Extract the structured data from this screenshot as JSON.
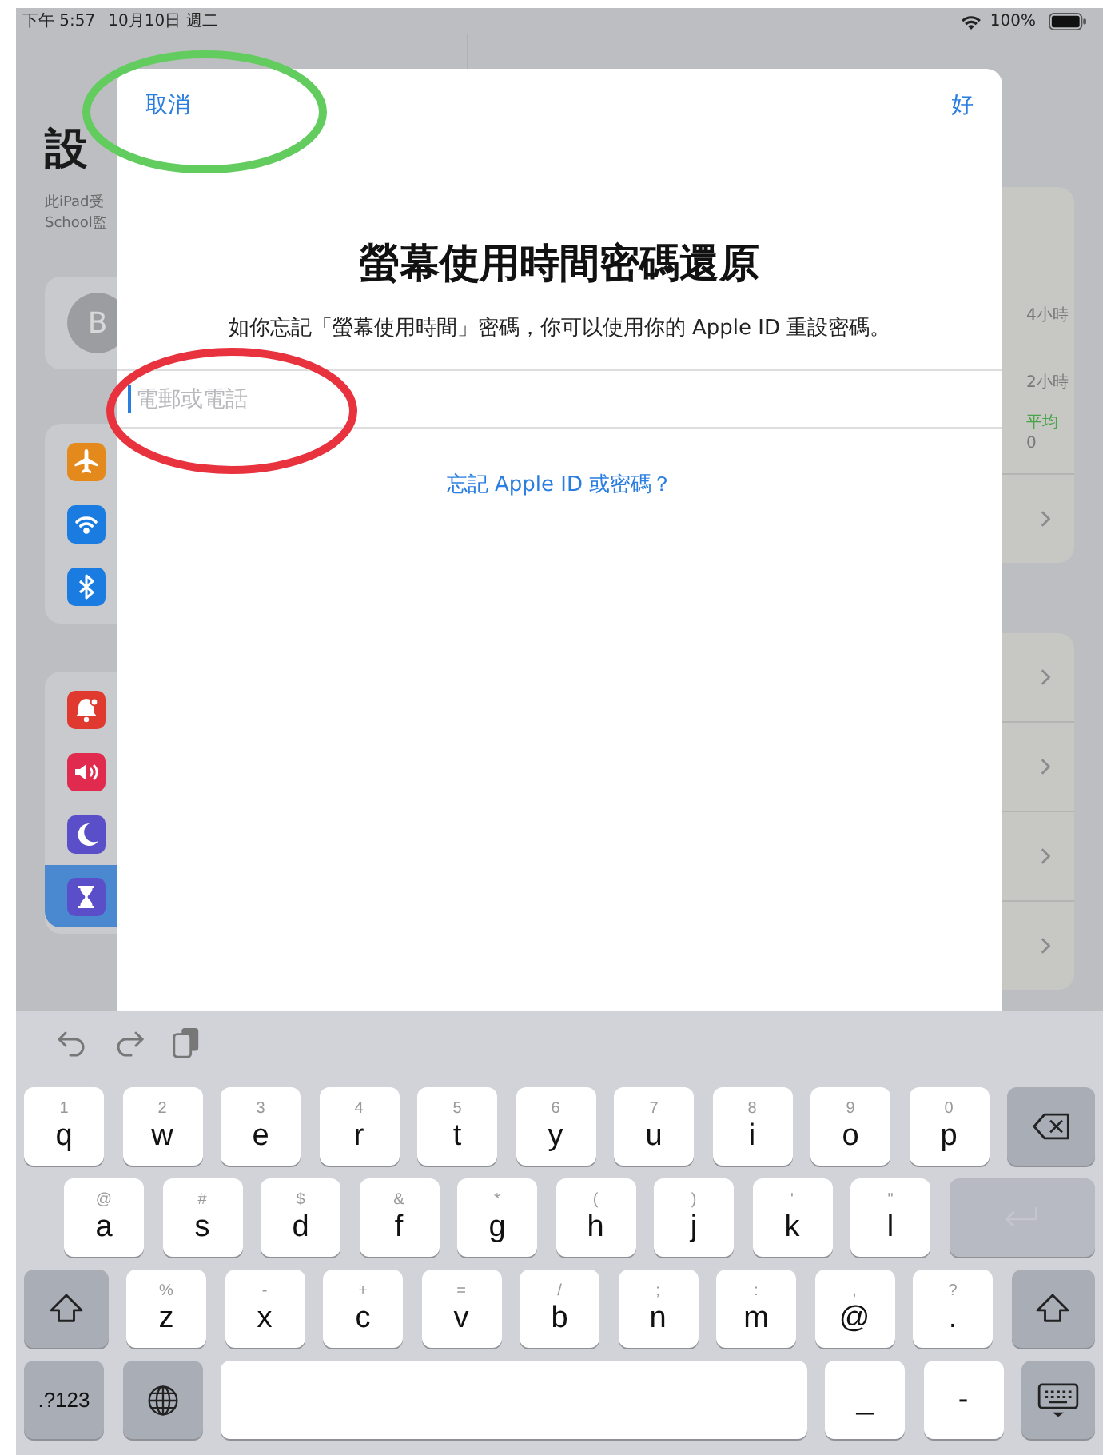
{
  "status_bar": {
    "time": "下午 5:57",
    "date": "10月10日 週二",
    "battery": "100%"
  },
  "settings": {
    "title": "設",
    "note_lines": [
      "此iPad受",
      "School監"
    ],
    "avatar": "B",
    "groups": [
      [
        {
          "kind": "airplane",
          "color": "#e48a1c",
          "selected": false
        },
        {
          "kind": "wifi",
          "color": "#1a7ce0",
          "selected": false
        },
        {
          "kind": "bluetooth",
          "color": "#1a7ce0",
          "selected": false
        }
      ],
      [
        {
          "kind": "bell",
          "color": "#e0392f",
          "selected": false
        },
        {
          "kind": "sound",
          "color": "#e02a4e",
          "selected": false
        },
        {
          "kind": "moon",
          "color": "#5a4fc8",
          "selected": false
        },
        {
          "kind": "hourglass",
          "color": "#5a4fc8",
          "selected": true
        }
      ]
    ]
  },
  "detail": {
    "stats": [
      {
        "text": "4小時",
        "kind": "plain"
      },
      {
        "text": "2小時",
        "kind": "plain"
      },
      {
        "text": "平均",
        "kind": "green"
      },
      {
        "text": "0",
        "kind": "plain"
      }
    ]
  },
  "sheet": {
    "cancel": "取消",
    "done": "好",
    "title": "螢幕使用時間密碼還原",
    "message": "如你忘記「螢幕使用時間」密碼，你可以使用你的 Apple ID 重設密碼。",
    "field": {
      "placeholder": "電郵或電話"
    },
    "link": "忘記 Apple ID 或密碼？"
  },
  "annotations": [
    {
      "kind": "ellipse",
      "color": "#62cc5e"
    },
    {
      "kind": "ellipse",
      "color": "#e8333f"
    }
  ],
  "keyboard": {
    "rows": [
      [
        {
          "kind": "letter",
          "label": "q",
          "secondary": "1"
        },
        {
          "kind": "letter",
          "label": "w",
          "secondary": "2"
        },
        {
          "kind": "letter",
          "label": "e",
          "secondary": "3"
        },
        {
          "kind": "letter",
          "label": "r",
          "secondary": "4"
        },
        {
          "kind": "letter",
          "label": "t",
          "secondary": "5"
        },
        {
          "kind": "letter",
          "label": "y",
          "secondary": "6"
        },
        {
          "kind": "letter",
          "label": "u",
          "secondary": "7"
        },
        {
          "kind": "letter",
          "label": "i",
          "secondary": "8"
        },
        {
          "kind": "letter",
          "label": "o",
          "secondary": "9"
        },
        {
          "kind": "letter",
          "label": "p",
          "secondary": "0"
        },
        {
          "kind": "delete"
        }
      ],
      [
        {
          "kind": "letter",
          "label": "a",
          "secondary": "@"
        },
        {
          "kind": "letter",
          "label": "s",
          "secondary": "#"
        },
        {
          "kind": "letter",
          "label": "d",
          "secondary": "$"
        },
        {
          "kind": "letter",
          "label": "f",
          "secondary": "&"
        },
        {
          "kind": "letter",
          "label": "g",
          "secondary": "*"
        },
        {
          "kind": "letter",
          "label": "h",
          "secondary": "("
        },
        {
          "kind": "letter",
          "label": "j",
          "secondary": ")"
        },
        {
          "kind": "letter",
          "label": "k",
          "secondary": "'"
        },
        {
          "kind": "letter",
          "label": "l",
          "secondary": "\""
        },
        {
          "kind": "return",
          "disabled": true
        }
      ],
      [
        {
          "kind": "shift"
        },
        {
          "kind": "letter",
          "label": "z",
          "secondary": "%"
        },
        {
          "kind": "letter",
          "label": "x",
          "secondary": "-"
        },
        {
          "kind": "letter",
          "label": "c",
          "secondary": "+"
        },
        {
          "kind": "letter",
          "label": "v",
          "secondary": "="
        },
        {
          "kind": "letter",
          "label": "b",
          "secondary": "/"
        },
        {
          "kind": "letter",
          "label": "n",
          "secondary": ";"
        },
        {
          "kind": "letter",
          "label": "m",
          "secondary": ":"
        },
        {
          "kind": "letter",
          "label": "@",
          "secondary": ","
        },
        {
          "kind": "letter",
          "label": ".",
          "secondary": "?"
        },
        {
          "kind": "shift"
        }
      ],
      [
        {
          "kind": "mode",
          "label": ".?123"
        },
        {
          "kind": "globe"
        },
        {
          "kind": "space"
        },
        {
          "kind": "letter",
          "label": "_"
        },
        {
          "kind": "letter",
          "label": "-"
        },
        {
          "kind": "hide"
        }
      ]
    ]
  }
}
